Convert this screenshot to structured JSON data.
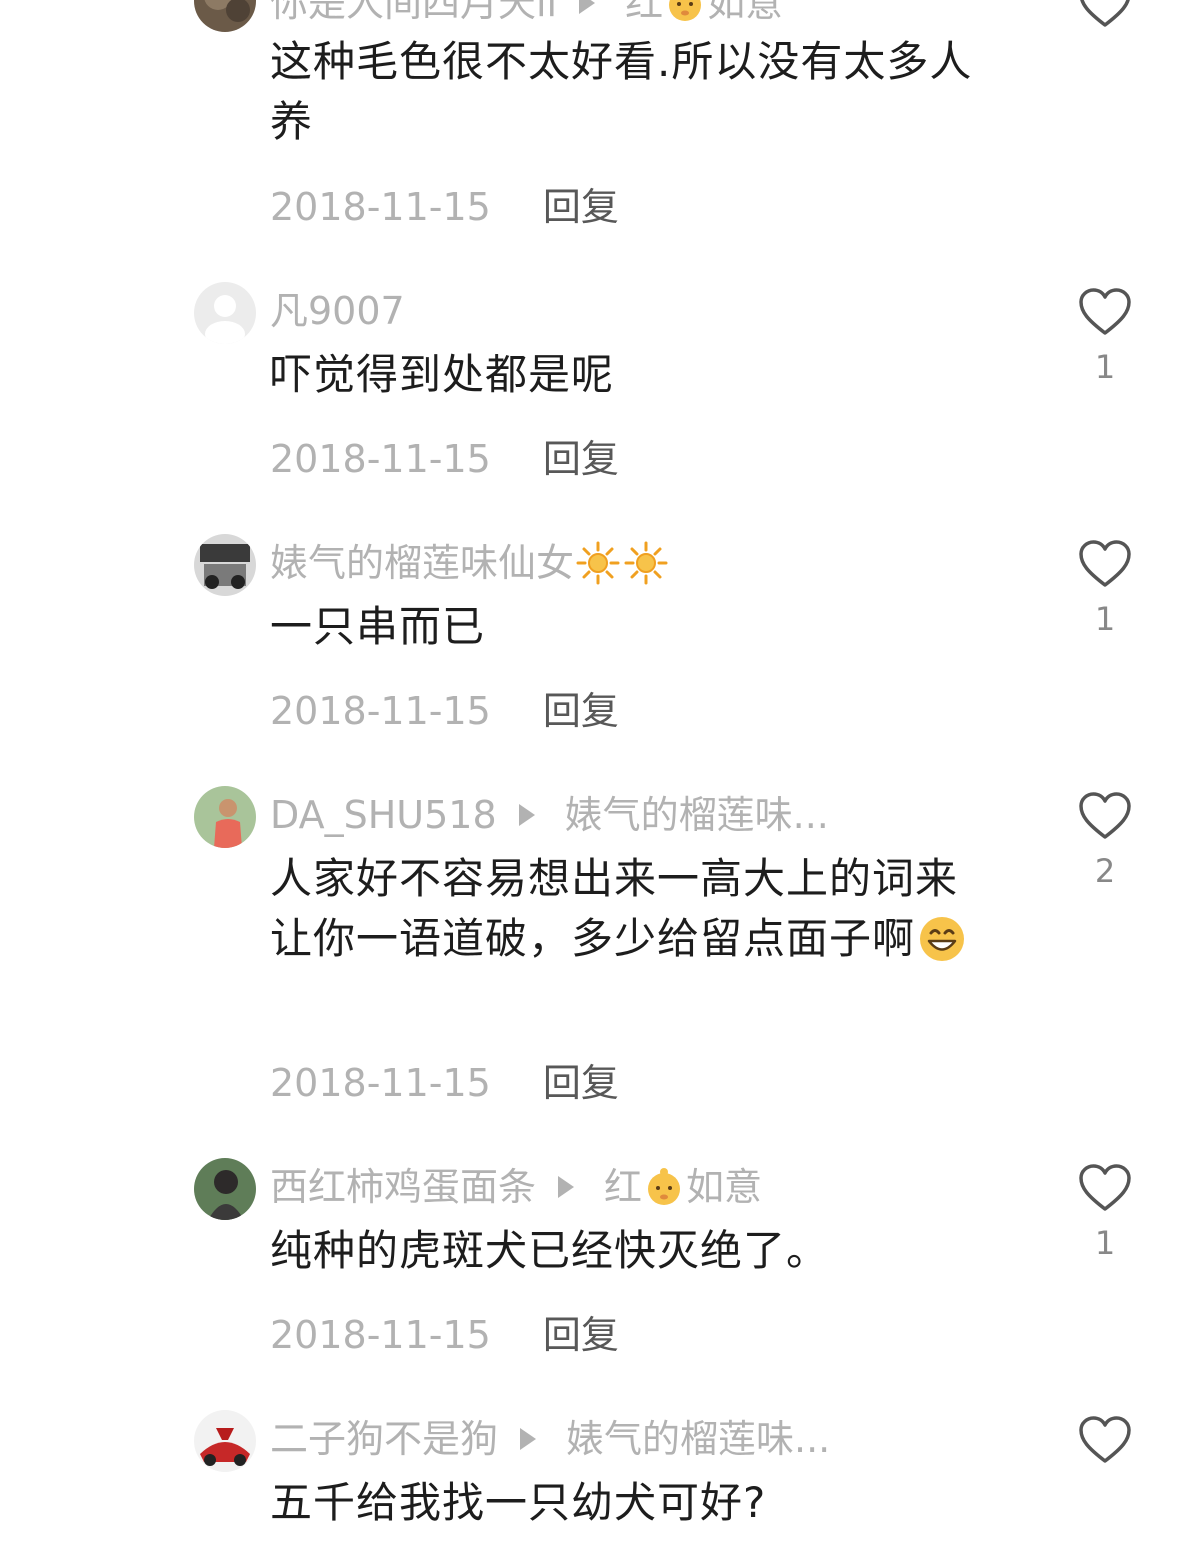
{
  "comments": [
    {
      "user": "你是人间四月天ll",
      "reply_to": "红",
      "reply_to_tail": "如意",
      "text": "这种毛色很不太好看.所以没有太多人养",
      "date": "2018-11-15",
      "reply_label": "回复",
      "likes": null
    },
    {
      "user": "凡9007",
      "text": "吓觉得到处都是呢",
      "date": "2018-11-15",
      "reply_label": "回复",
      "likes": "1"
    },
    {
      "user": "婊气的榴莲味仙女",
      "text": "一只串而已",
      "date": "2018-11-15",
      "reply_label": "回复",
      "likes": "1"
    },
    {
      "user": "DA_SHU518",
      "reply_to": "婊气的榴莲味...",
      "text": "人家好不容易想出来一高大上的词来让你一语道破，多少给留点面子啊",
      "date": "2018-11-15",
      "reply_label": "回复",
      "likes": "2"
    },
    {
      "user": "西红柿鸡蛋面条",
      "reply_to": "红",
      "reply_to_tail": "如意",
      "text": "纯种的虎斑犬已经快灭绝了。",
      "date": "2018-11-15",
      "reply_label": "回复",
      "likes": "1"
    },
    {
      "user": "二子狗不是狗",
      "reply_to": "婊气的榴莲味...",
      "text": "五千给我找一只幼犬可好?",
      "likes": null
    }
  ],
  "icons": {
    "like": "heart-outline-icon",
    "reply_arrow": "play-triangle-icon",
    "baby": "baby-emoji-icon",
    "sun": "sun-emoji-icon",
    "grin": "grinning-face-emoji-icon"
  },
  "colors": {
    "name": "#b2b2b2",
    "text": "#1d1d1d",
    "reply": "#585858",
    "count": "#888888"
  }
}
